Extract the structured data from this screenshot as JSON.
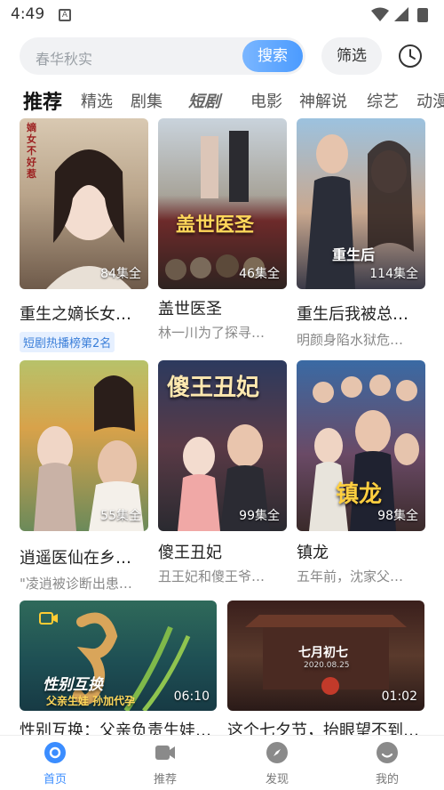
{
  "status": {
    "time": "4:49",
    "app_icon_letter": "A"
  },
  "search": {
    "placeholder": "春华秋实",
    "button": "搜索",
    "filter": "筛选"
  },
  "tabs": [
    "推荐",
    "精选",
    "剧集",
    "短剧",
    "电影",
    "神解说",
    "综艺",
    "动漫"
  ],
  "grid": [
    {
      "title": "重生之嫡长女…",
      "tag": "短剧热播榜第2名",
      "badge": "84集全",
      "overlay": "嫡女不好惹"
    },
    {
      "title": "盖世医圣",
      "sub": "林一川为了探寻…",
      "badge": "46集全",
      "overlay": "盖世医圣"
    },
    {
      "title": "重生后我被总…",
      "sub": "明颜身陷水狱危…",
      "badge": "114集全",
      "overlay": "重生后"
    },
    {
      "title": "逍遥医仙在乡…",
      "sub": "\"凌逍被诊断出患…",
      "badge": "55集全"
    },
    {
      "title": "傻王丑妃",
      "sub": "丑王妃和傻王爷…",
      "badge": "99集全",
      "overlay": "傻王丑妃"
    },
    {
      "title": "镇龙",
      "sub": "五年前，沈家父…",
      "badge": "98集全",
      "overlay": "镇龙"
    }
  ],
  "wide": [
    {
      "title": "性别互换：父亲负责生娃…",
      "duration": "06:10",
      "overlay": "性别互换",
      "overlay2": "父亲生娃 孙加代孕"
    },
    {
      "title": "这个七夕节，抬眼望不到天…",
      "duration": "01:02",
      "overlay": "七月初七",
      "overlay2": "2020.08.25"
    }
  ],
  "nav": [
    {
      "label": "首页",
      "icon": "home-icon"
    },
    {
      "label": "推荐",
      "icon": "video-icon"
    },
    {
      "label": "发现",
      "icon": "compass-icon"
    },
    {
      "label": "我的",
      "icon": "profile-icon"
    }
  ],
  "colors": {
    "accent": "#3b8dff"
  }
}
